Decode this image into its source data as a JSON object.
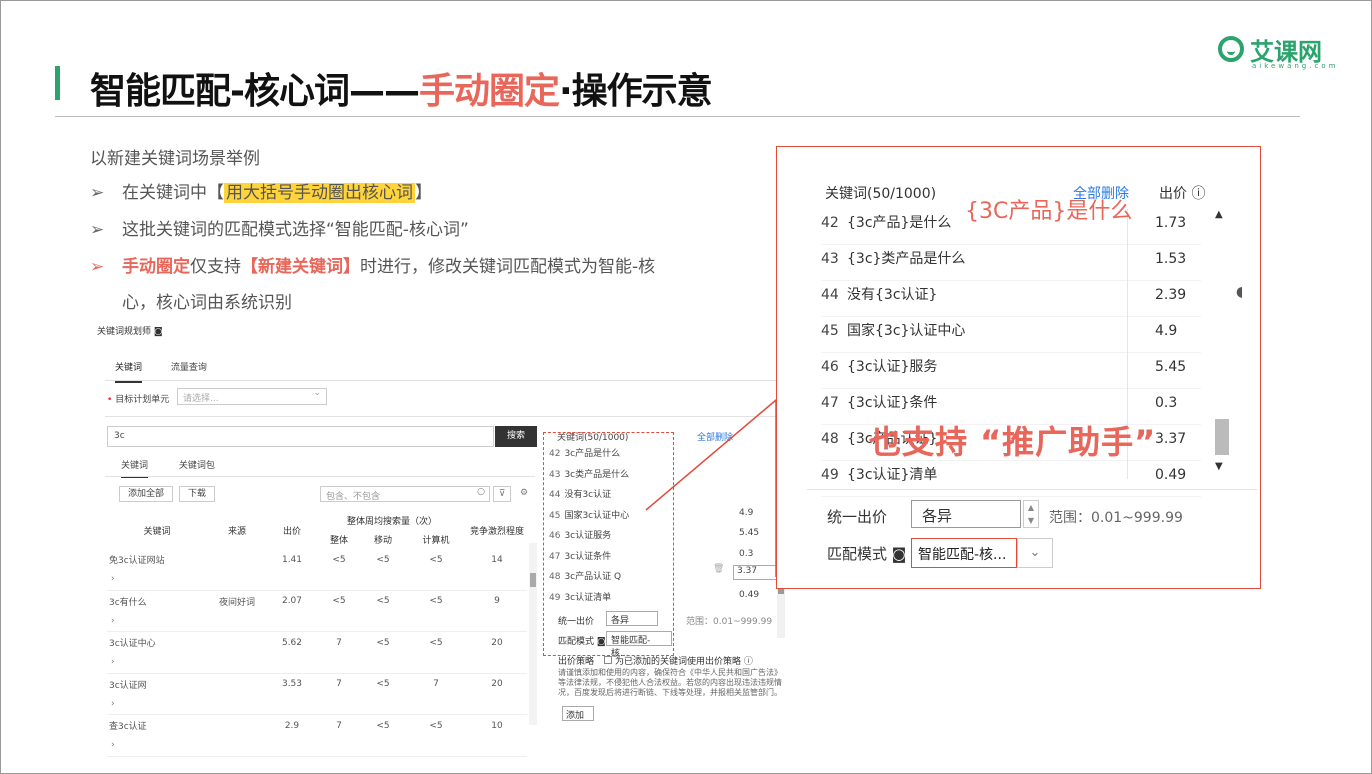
{
  "slide": {
    "title_pre": "智能匹配-核心词——",
    "title_highlight": "手动圈定",
    "title_post": "·操作示意",
    "logo_text": "艾课网",
    "logo_sub": "aikewang.com",
    "intro": "以新建关键词场景举例",
    "bullet1_pre": "在关键词中【",
    "bullet1_marked": "用大括号手动圈出核心词",
    "bullet1_post": "】",
    "bullet2": "这批关键词的匹配模式选择“智能匹配-核心词”",
    "bullet3_red1": "手动圈定",
    "bullet3_mid": "仅支持",
    "bullet3_red2": "【新建关键词】",
    "bullet3_post": "时进行，修改关键词匹配模式为智能-核",
    "bullet4": "心，核心词由系统识别",
    "arrow": "➢"
  },
  "screenshot": {
    "title": "关键词规划师 ◙",
    "tab_keyword": "关键词",
    "tab_traffic": "流量查询",
    "target_label": "目标计划单元",
    "required_mark": "•",
    "target_placeholder": "请选择...",
    "search_value": "3c",
    "search_button": "搜索",
    "subtab_keyword": "关键词",
    "subtab_package": "关键词包",
    "add_all": "添加全部",
    "download": "下载",
    "filter_placeholder": "包含、不包含",
    "col_keyword": "关键词",
    "col_source": "来源",
    "col_price": "出价",
    "col_volume": "整体周均搜索量（次）",
    "col_total": "整体",
    "col_mobile": "移动",
    "col_pc": "计算机",
    "col_competition": "竞争激烈程度",
    "rows": [
      {
        "kw": "免3c认证网站",
        "src": "",
        "price": "1.41",
        "total": "<5",
        "mobile": "<5",
        "pc": "<5",
        "comp": "14"
      },
      {
        "kw": "3c有什么",
        "src": "夜间好词",
        "price": "2.07",
        "total": "<5",
        "mobile": "<5",
        "pc": "<5",
        "comp": "9"
      },
      {
        "kw": "3c认证中心",
        "src": "",
        "price": "5.62",
        "total": "7",
        "mobile": "<5",
        "pc": "<5",
        "comp": "20"
      },
      {
        "kw": "3c认证网",
        "src": "",
        "price": "3.53",
        "total": "7",
        "mobile": "<5",
        "pc": "7",
        "comp": "20"
      },
      {
        "kw": "查3c认证",
        "src": "",
        "price": "2.9",
        "total": "7",
        "mobile": "<5",
        "pc": "<5",
        "comp": "10"
      }
    ],
    "row_expand": "›",
    "sel_head": "关键词(50/1000)",
    "sel_clear": "全部删除",
    "sel_rows": [
      {
        "n": "42",
        "kw": "3c产品是什么",
        "p": ""
      },
      {
        "n": "43",
        "kw": "3c类产品是什么",
        "p": ""
      },
      {
        "n": "44",
        "kw": "没有3c认证",
        "p": ""
      },
      {
        "n": "45",
        "kw": "国家3c认证中心",
        "p": "4.9"
      },
      {
        "n": "46",
        "kw": "3c认证服务",
        "p": "5.45"
      },
      {
        "n": "47",
        "kw": "3c认证条件",
        "p": "0.3"
      },
      {
        "n": "48",
        "kw": "3c产品认证 Q",
        "p": ""
      },
      {
        "n": "49",
        "kw": "3c认证清单",
        "p": "0.49"
      }
    ],
    "sel_input_value": "3.37",
    "sel_delete": "🗑",
    "unify_label": "统一出价",
    "unify_value": "各异",
    "range": "范围：0.01~999.99",
    "mode_label": "匹配模式 ◙",
    "mode_value": "智能匹配-核...",
    "strategy_label": "出价策略",
    "strategy_check": "为已添加的关键词使用出价策略 ⓘ",
    "notice": "请谨慎添加和使用的内容，确保符合《中华人民共和国广告法》等法律法规，不侵犯他人合法权益。若您的内容出现违法违规情况，百度发现后将进行断链、下线等处理，并报相关监管部门。",
    "add_button": "添加"
  },
  "zoom": {
    "head": "关键词(50/1000)",
    "clear": "全部删除",
    "price_head": "出价 ⓘ",
    "rows": [
      {
        "n": "42",
        "kw": "{3c产品}是什么",
        "p": "1.73"
      },
      {
        "n": "43",
        "kw": "{3c}类产品是什么",
        "p": "1.53"
      },
      {
        "n": "44",
        "kw": "没有{3c认证}",
        "p": "2.39"
      },
      {
        "n": "45",
        "kw": "国家{3c}认证中心",
        "p": "4.9"
      },
      {
        "n": "46",
        "kw": "{3c认证}服务",
        "p": "5.45"
      },
      {
        "n": "47",
        "kw": "{3c认证}条件",
        "p": "0.3"
      },
      {
        "n": "48",
        "kw": "{3c产品认证}",
        "p": "3.37"
      },
      {
        "n": "49",
        "kw": "{3c认证}清单",
        "p": "0.49"
      }
    ],
    "annotation": "{3C产品}是什么",
    "big_text": "也支持 “推广助手”",
    "unify_label": "统一出价",
    "unify_value": "各异",
    "range": "范围：0.01~999.99",
    "mode_label": "匹配模式 ◙",
    "mode_value": "智能匹配-核...",
    "mode_caret": "⌄",
    "scroll_up": "▲",
    "scroll_down": "▼"
  }
}
